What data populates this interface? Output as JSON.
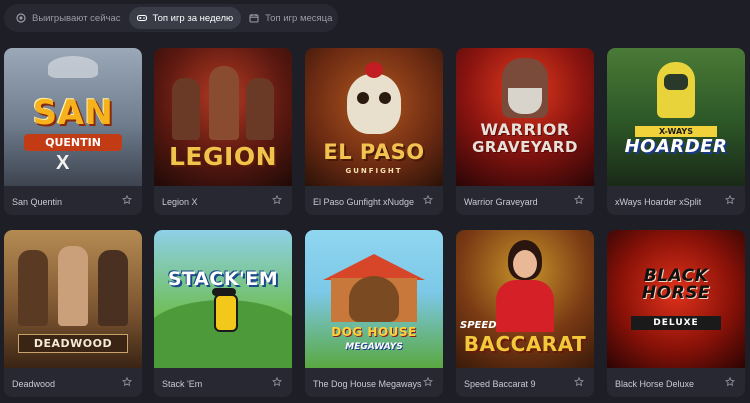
{
  "tabs": [
    {
      "label": "Выигрывают сейчас",
      "icon": "live-icon",
      "active": false
    },
    {
      "label": "Топ игр за неделю",
      "icon": "gamepad-icon",
      "active": true
    },
    {
      "label": "Топ игр месяца",
      "icon": "calendar-icon",
      "active": false
    }
  ],
  "games": [
    {
      "title": "San Quentin",
      "logo": "SAN",
      "sub": "QUENTIN"
    },
    {
      "title": "Legion X",
      "logo": "LEGION",
      "sub": ""
    },
    {
      "title": "El Paso Gunfight xNudge",
      "logo": "EL PASO",
      "sub": "GUNFIGHT"
    },
    {
      "title": "Warrior Graveyard",
      "logo": "WARRIOR",
      "sub": "GRAVEYARD"
    },
    {
      "title": "xWays Hoarder xSplit",
      "logo": "HOARDER",
      "sub": "X-WAYS"
    },
    {
      "title": "Deadwood",
      "logo": "DEADWOOD",
      "sub": ""
    },
    {
      "title": "Stack 'Em",
      "logo": "STACK'EM",
      "sub": ""
    },
    {
      "title": "The Dog House Megaways",
      "logo": "DOG HOUSE",
      "sub": "MEGAWAYS"
    },
    {
      "title": "Speed Baccarat 9",
      "logo": "BACCARAT",
      "sub": "SPEED"
    },
    {
      "title": "Black Horse Deluxe",
      "logo": "BLACK HORSE",
      "sub": "DELUXE"
    }
  ]
}
